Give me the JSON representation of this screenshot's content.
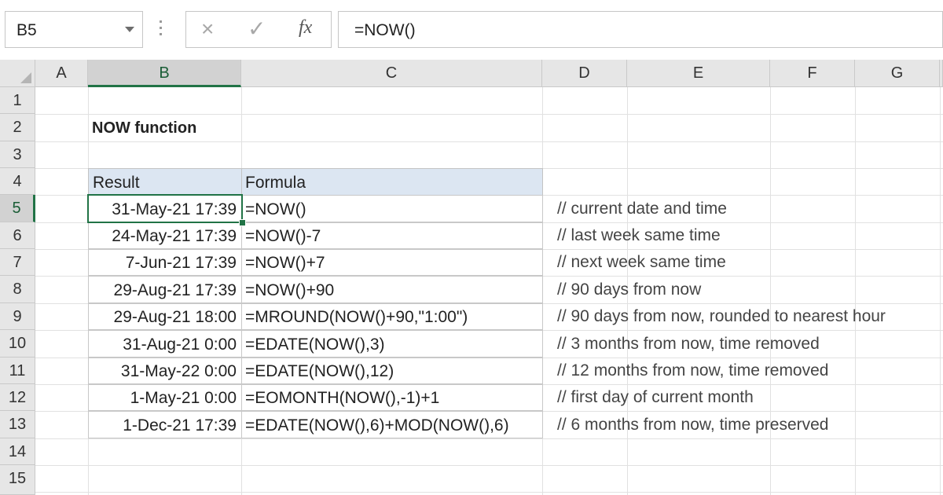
{
  "formula_bar": {
    "name_box": "B5",
    "cancel_icon": "×",
    "enter_icon": "✓",
    "fx_label": "fx",
    "formula": "=NOW()"
  },
  "columns": [
    "A",
    "B",
    "C",
    "D",
    "E",
    "F",
    "G"
  ],
  "selected_column": "B",
  "rows": [
    "1",
    "2",
    "3",
    "4",
    "5",
    "6",
    "7",
    "8",
    "9",
    "10",
    "11",
    "12",
    "13",
    "14",
    "15"
  ],
  "selected_row": "5",
  "sheet": {
    "title": "NOW function",
    "table_headers": {
      "result": "Result",
      "formula": "Formula"
    },
    "table_rows": [
      {
        "result": "31-May-21 17:39",
        "formula": "=NOW()",
        "note": "// current date and time"
      },
      {
        "result": "24-May-21 17:39",
        "formula": "=NOW()-7",
        "note": "// last week same time"
      },
      {
        "result": "7-Jun-21 17:39",
        "formula": "=NOW()+7",
        "note": "// next week same time"
      },
      {
        "result": "29-Aug-21 17:39",
        "formula": "=NOW()+90",
        "note": "// 90 days from now"
      },
      {
        "result": "29-Aug-21 18:00",
        "formula": "=MROUND(NOW()+90,\"1:00\")",
        "note": "// 90 days from now, rounded to nearest hour"
      },
      {
        "result": "31-Aug-21 0:00",
        "formula": "=EDATE(NOW(),3)",
        "note": "// 3 months from now, time removed"
      },
      {
        "result": "31-May-22 0:00",
        "formula": "=EDATE(NOW(),12)",
        "note": "// 12 months from now, time removed"
      },
      {
        "result": "1-May-21 0:00",
        "formula": "=EOMONTH(NOW(),-1)+1",
        "note": "// first day of current month"
      },
      {
        "result": "1-Dec-21 17:39",
        "formula": "=EDATE(NOW(),6)+MOD(NOW(),6)",
        "note": "// 6 months from now, time preserved"
      }
    ]
  },
  "colors": {
    "accent": "#217346",
    "header_fill": "#dce6f2",
    "grid_header": "#e6e6e6"
  }
}
